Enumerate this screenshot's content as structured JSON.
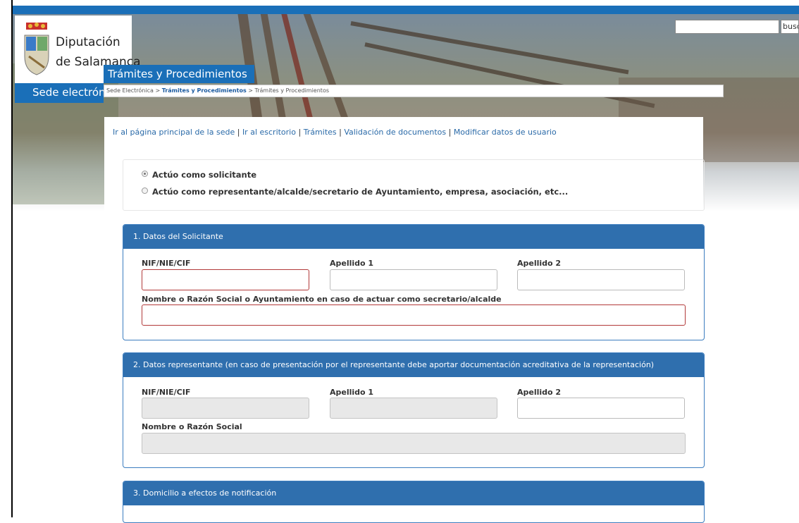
{
  "logo": {
    "line1": "Diputación",
    "line2": "de Salamanca"
  },
  "header": {
    "sede_label": "Sede electrón",
    "section_tab": "Trámites y Procedimientos"
  },
  "search": {
    "button_label": "busc",
    "placeholder": ""
  },
  "breadcrumb": {
    "item1": "Sede Electrónica",
    "item2": "Trámites y Procedimientos",
    "item3": "Trámites y Procedimientos",
    "separator": ">"
  },
  "toplinks": [
    "Ir al página principal de la sede",
    "Ir al escritorio",
    "Trámites",
    "Validación de documentos",
    "Modificar datos de usuario"
  ],
  "roles": {
    "option1": "Actúo como solicitante",
    "option2": "Actúo como representante/alcalde/secretario de Ayuntamiento, empresa, asociación, etc...",
    "selected": "option1"
  },
  "section1": {
    "title": "1. Datos del Solicitante",
    "nif_label": "NIF/NIE/CIF",
    "apellido1_label": "Apellido 1",
    "apellido2_label": "Apellido 2",
    "nombre_label": "Nombre o Razón Social o Ayuntamiento en caso de actuar como secretario/alcalde"
  },
  "section2": {
    "title": "2. Datos representante (en caso de presentación por el representante debe aportar documentación acreditativa de la representación)",
    "nif_label": "NIF/NIE/CIF",
    "apellido1_label": "Apellido 1",
    "apellido2_label": "Apellido 2",
    "nombre_label": "Nombre o Razón Social"
  },
  "section3": {
    "title": "3. Domicilio a efectos de notificación"
  },
  "colors": {
    "brand_blue": "#1a6fb8",
    "panel_head": "#2f6fae",
    "link": "#2a6aa8",
    "required_border": "#b23a3a"
  }
}
